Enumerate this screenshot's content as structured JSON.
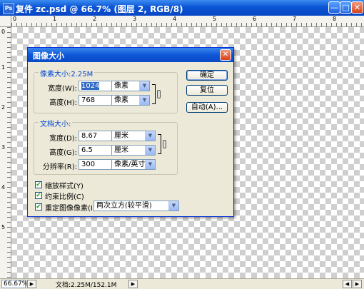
{
  "window": {
    "title": "复件 zc.psd @ 66.7% (图层 2, RGB/8)",
    "icon": "Ps",
    "min_glyph": "—",
    "max_glyph": "□",
    "close_glyph": "✕"
  },
  "rulers": {
    "top": [
      "0",
      "1",
      "2",
      "3",
      "4",
      "5",
      "6",
      "7",
      "8"
    ],
    "left": [
      "0",
      "1",
      "2",
      "3",
      "4",
      "5"
    ]
  },
  "status": {
    "zoom": "66.67%",
    "doc": "文档:2.25M/152.1M"
  },
  "dialog": {
    "title": "图像大小",
    "close_glyph": "✕",
    "pixel_dimensions": {
      "title": "像素大小:2.25M",
      "width_label": "宽度(W):",
      "width_value": "1024",
      "width_unit": "像素",
      "height_label": "高度(H):",
      "height_value": "768",
      "height_unit": "像素"
    },
    "document_size": {
      "title": "文档大小:",
      "width_label": "宽度(D):",
      "width_value": "8.67",
      "width_unit": "厘米",
      "height_label": "高度(G):",
      "height_value": "6.5",
      "height_unit": "厘米",
      "resolution_label": "分辨率(R):",
      "resolution_value": "300",
      "resolution_unit": "像素/英寸"
    },
    "buttons": {
      "ok": "确定",
      "reset": "复位",
      "auto": "自动(A)..."
    },
    "options": {
      "scale_styles": "缩放样式(Y)",
      "constrain": "约束比例(C)",
      "resample": "重定图像像素(I):",
      "resample_method": "两次立方(较平滑)"
    }
  }
}
